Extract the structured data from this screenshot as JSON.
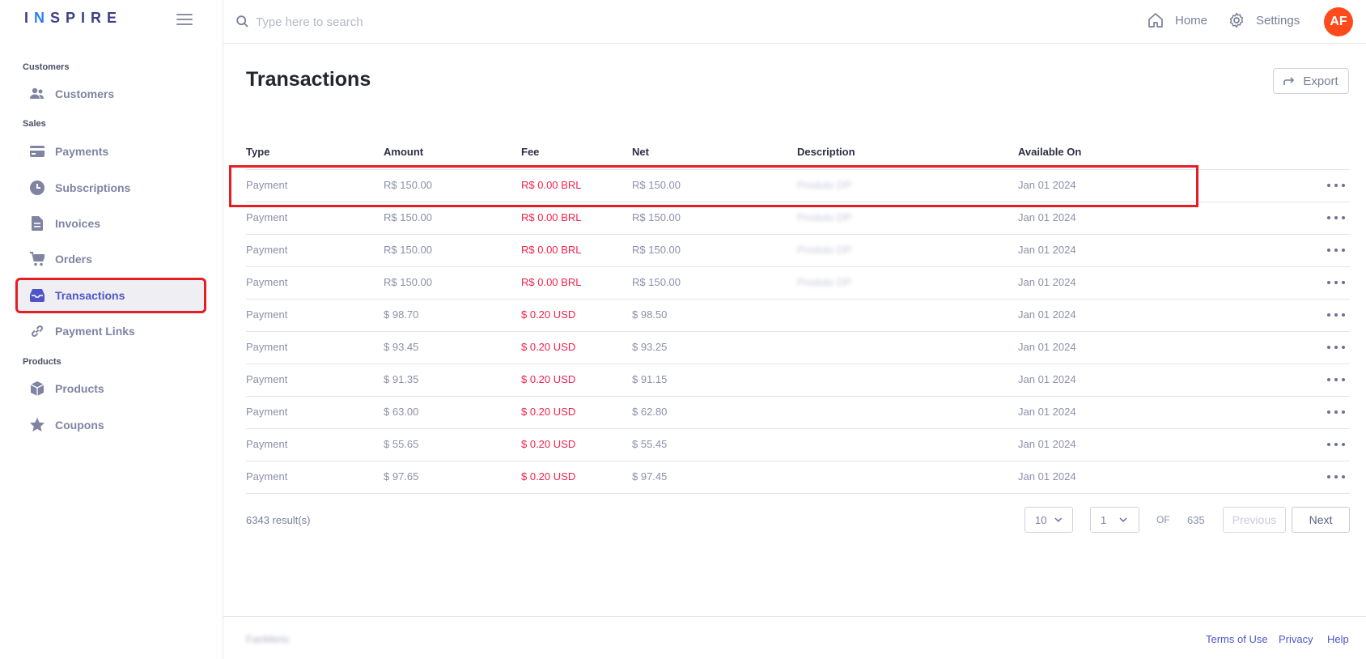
{
  "brand": {
    "logo_text_a": "I",
    "logo_text_n": "N",
    "logo_text_b": "SPIRE"
  },
  "search": {
    "placeholder": "Type here to search"
  },
  "top_nav": {
    "home": "Home",
    "settings": "Settings",
    "avatar_initials": "AF"
  },
  "sidebar": {
    "sections": [
      {
        "label": "Customers",
        "items": [
          {
            "label": "Customers",
            "icon": "users-icon"
          }
        ]
      },
      {
        "label": "Sales",
        "items": [
          {
            "label": "Payments",
            "icon": "credit-card-icon"
          },
          {
            "label": "Subscriptions",
            "icon": "clock-icon"
          },
          {
            "label": "Invoices",
            "icon": "document-icon"
          },
          {
            "label": "Orders",
            "icon": "cart-icon"
          },
          {
            "label": "Transactions",
            "icon": "inbox-icon",
            "active": true
          },
          {
            "label": "Payment Links",
            "icon": "link-icon"
          }
        ]
      },
      {
        "label": "Products",
        "items": [
          {
            "label": "Products",
            "icon": "box-icon"
          },
          {
            "label": "Coupons",
            "icon": "star-icon"
          }
        ]
      }
    ]
  },
  "main": {
    "title": "Transactions",
    "export_label": "Export",
    "columns": [
      "Type",
      "Amount",
      "Fee",
      "Net",
      "Description",
      "Available On"
    ],
    "rows": [
      {
        "type": "Payment",
        "amount": "R$ 150.00",
        "fee": "R$ 0.00 BRL",
        "net": "R$ 150.00",
        "description": "Produto DP",
        "available_on": "Jan 01 2024"
      },
      {
        "type": "Payment",
        "amount": "R$ 150.00",
        "fee": "R$ 0.00 BRL",
        "net": "R$ 150.00",
        "description": "Produto DP",
        "available_on": "Jan 01 2024"
      },
      {
        "type": "Payment",
        "amount": "R$ 150.00",
        "fee": "R$ 0.00 BRL",
        "net": "R$ 150.00",
        "description": "Produto DP",
        "available_on": "Jan 01 2024"
      },
      {
        "type": "Payment",
        "amount": "R$ 150.00",
        "fee": "R$ 0.00 BRL",
        "net": "R$ 150.00",
        "description": "Produto DP",
        "available_on": "Jan 01 2024"
      },
      {
        "type": "Payment",
        "amount": "$ 98.70",
        "fee": "$ 0.20 USD",
        "net": "$ 98.50",
        "description": "",
        "available_on": "Jan 01 2024"
      },
      {
        "type": "Payment",
        "amount": "$ 93.45",
        "fee": "$ 0.20 USD",
        "net": "$ 93.25",
        "description": "",
        "available_on": "Jan 01 2024"
      },
      {
        "type": "Payment",
        "amount": "$ 91.35",
        "fee": "$ 0.20 USD",
        "net": "$ 91.15",
        "description": "",
        "available_on": "Jan 01 2024"
      },
      {
        "type": "Payment",
        "amount": "$ 63.00",
        "fee": "$ 0.20 USD",
        "net": "$ 62.80",
        "description": "",
        "available_on": "Jan 01 2024"
      },
      {
        "type": "Payment",
        "amount": "$ 55.65",
        "fee": "$ 0.20 USD",
        "net": "$ 55.45",
        "description": "",
        "available_on": "Jan 01 2024"
      },
      {
        "type": "Payment",
        "amount": "$ 97.65",
        "fee": "$ 0.20 USD",
        "net": "$ 97.45",
        "description": "",
        "available_on": "Jan 01 2024"
      }
    ],
    "results_text": "6343 result(s)",
    "pagination": {
      "page_size": "10",
      "current_page": "1",
      "of_label": "OF",
      "total_pages": "635",
      "previous": "Previous",
      "next": "Next"
    }
  },
  "footer": {
    "brand": "FanMeric",
    "links": [
      "Terms of Use",
      "Privacy",
      "Help"
    ]
  },
  "colors": {
    "accent": "#4f55c9",
    "fee_red": "#f0224d",
    "avatar": "#ff4a1c",
    "highlight": "#e51e25"
  }
}
